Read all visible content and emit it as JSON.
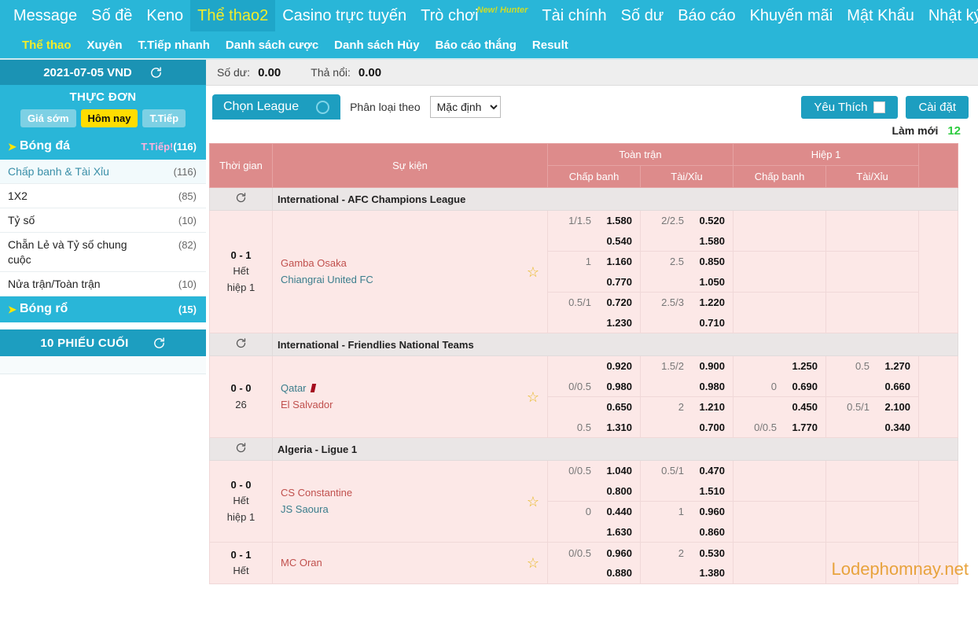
{
  "topnav": {
    "items": [
      {
        "label": "Message",
        "active": false
      },
      {
        "label": "Số đề",
        "active": false
      },
      {
        "label": "Keno",
        "active": false
      },
      {
        "label": "Thể thao2",
        "active": true
      },
      {
        "label": "Casino trực tuyến",
        "active": false
      },
      {
        "label": "Trò chơi",
        "active": false,
        "sup": "New! Hunter"
      },
      {
        "label": "Tài chính",
        "active": false
      },
      {
        "label": "Số dư",
        "active": false
      },
      {
        "label": "Báo cáo",
        "active": false
      },
      {
        "label": "Khuyến mãi",
        "active": false
      },
      {
        "label": "Mật Khẩu",
        "active": false
      },
      {
        "label": "Nhật ký",
        "active": false
      }
    ]
  },
  "subnav": {
    "items": [
      {
        "label": "Thể thao",
        "active": true
      },
      {
        "label": "Xuyên",
        "active": false
      },
      {
        "label": "T.Tiếp nhanh",
        "active": false
      },
      {
        "label": "Danh sách cược",
        "active": false
      },
      {
        "label": "Danh sách Hủy",
        "active": false
      },
      {
        "label": "Báo cáo thắng",
        "active": false
      },
      {
        "label": "Result",
        "active": false
      }
    ]
  },
  "sidebar": {
    "date_label": "2021-07-05 VND",
    "menu_title": "THỰC ĐƠN",
    "tabs": [
      {
        "label": "Giá sớm",
        "selected": false
      },
      {
        "label": "Hôm nay",
        "selected": true
      },
      {
        "label": "T.Tiếp",
        "selected": false
      }
    ],
    "football": {
      "label": "Bóng đá",
      "live": "T.Tiếp!",
      "count": "(116)"
    },
    "items": [
      {
        "label": "Chấp banh & Tài Xỉu",
        "count": "(116)"
      },
      {
        "label": "1X2",
        "count": "(85)"
      },
      {
        "label": "Tỷ số",
        "count": "(10)"
      },
      {
        "label": "Chẵn Lẻ và Tỷ số chung",
        "count": "(82)"
      },
      {
        "label": "cuộc",
        "count": ""
      },
      {
        "label": "Nửa trận/Toàn trận",
        "count": "(10)"
      }
    ],
    "basketball": {
      "label": "Bóng rổ",
      "count": "(15)"
    },
    "last_tickets": "10 PHIẾU CUỐI"
  },
  "balance": {
    "balance_label": "Số dư:",
    "balance_value": "0.00",
    "float_label": "Thả nổi:",
    "float_value": "0.00"
  },
  "controls": {
    "choose_league": "Chọn League",
    "sort_label": "Phân loại theo",
    "sort_value": "Mặc định",
    "sort_options": [
      "Mặc định"
    ],
    "favourite": "Yêu Thích",
    "settings": "Cài đặt",
    "refresh_label": "Làm mới",
    "refresh_value": "12"
  },
  "table": {
    "headers": {
      "time": "Thời gian",
      "event": "Sự kiện",
      "full_match": "Toàn trận",
      "half_1": "Hiệp 1",
      "handicap": "Chấp banh",
      "over_under": "Tài/Xỉu"
    },
    "groups": [
      {
        "league": "International - AFC Champions League",
        "matches": [
          {
            "score": "0 - 1",
            "time_line2": "Hết",
            "time_line3": "hiệp 1",
            "home": "Gamba Osaka",
            "away": "Chiangrai United FC",
            "home_redcard": false,
            "rows": [
              {
                "fm_hcp": [
                  "1/1.5",
                  ""
                ],
                "fm_prc": [
                  "1.580",
                  "0.540"
                ],
                "ou_hcp": [
                  "2/2.5",
                  ""
                ],
                "ou_prc": [
                  "0.520",
                  "1.580"
                ],
                "h1_hcp": [
                  "",
                  ""
                ],
                "h1_prc": [
                  "",
                  ""
                ],
                "h1ou_hcp": [
                  "",
                  ""
                ],
                "h1ou_prc": [
                  "",
                  ""
                ]
              },
              {
                "fm_hcp": [
                  "1",
                  ""
                ],
                "fm_prc": [
                  "1.160",
                  "0.770"
                ],
                "ou_hcp": [
                  "2.5",
                  ""
                ],
                "ou_prc": [
                  "0.850",
                  "1.050"
                ],
                "h1_hcp": [
                  "",
                  ""
                ],
                "h1_prc": [
                  "",
                  ""
                ],
                "h1ou_hcp": [
                  "",
                  ""
                ],
                "h1ou_prc": [
                  "",
                  ""
                ]
              },
              {
                "fm_hcp": [
                  "0.5/1",
                  ""
                ],
                "fm_prc": [
                  "0.720",
                  "1.230"
                ],
                "ou_hcp": [
                  "2.5/3",
                  ""
                ],
                "ou_prc": [
                  "1.220",
                  "0.710"
                ],
                "h1_hcp": [
                  "",
                  ""
                ],
                "h1_prc": [
                  "",
                  ""
                ],
                "h1ou_hcp": [
                  "",
                  ""
                ],
                "h1ou_prc": [
                  "",
                  ""
                ]
              }
            ]
          }
        ]
      },
      {
        "league": "International - Friendlies National Teams",
        "matches": [
          {
            "score": "0 - 0",
            "time_line2": "26",
            "time_line3": "",
            "home": "Qatar",
            "away": "El Salvador",
            "home_redcard": true,
            "home_is_away_color": true,
            "rows": [
              {
                "fm_hcp": [
                  "",
                  "0/0.5"
                ],
                "fm_prc": [
                  "0.920",
                  "0.980"
                ],
                "ou_hcp": [
                  "1.5/2",
                  ""
                ],
                "ou_prc": [
                  "0.900",
                  "0.980"
                ],
                "h1_hcp": [
                  "",
                  "0"
                ],
                "h1_prc": [
                  "1.250",
                  "0.690"
                ],
                "h1ou_hcp": [
                  "0.5",
                  ""
                ],
                "h1ou_prc": [
                  "1.270",
                  "0.660"
                ]
              },
              {
                "fm_hcp": [
                  "",
                  "0.5"
                ],
                "fm_prc": [
                  "0.650",
                  "1.310"
                ],
                "ou_hcp": [
                  "2",
                  ""
                ],
                "ou_prc": [
                  "1.210",
                  "0.700"
                ],
                "h1_hcp": [
                  "",
                  "0/0.5"
                ],
                "h1_prc": [
                  "0.450",
                  "1.770"
                ],
                "h1ou_hcp": [
                  "0.5/1",
                  ""
                ],
                "h1ou_prc": [
                  "2.100",
                  "0.340"
                ]
              }
            ]
          }
        ]
      },
      {
        "league": "Algeria - Ligue 1",
        "matches": [
          {
            "score": "0 - 0",
            "time_line2": "Hết",
            "time_line3": "hiệp 1",
            "home": "CS Constantine",
            "away": "JS Saoura",
            "home_redcard": false,
            "rows": [
              {
                "fm_hcp": [
                  "0/0.5",
                  ""
                ],
                "fm_prc": [
                  "1.040",
                  "0.800"
                ],
                "ou_hcp": [
                  "0.5/1",
                  ""
                ],
                "ou_prc": [
                  "0.470",
                  "1.510"
                ],
                "h1_hcp": [
                  "",
                  ""
                ],
                "h1_prc": [
                  "",
                  ""
                ],
                "h1ou_hcp": [
                  "",
                  ""
                ],
                "h1ou_prc": [
                  "",
                  ""
                ]
              },
              {
                "fm_hcp": [
                  "0",
                  ""
                ],
                "fm_prc": [
                  "0.440",
                  "1.630"
                ],
                "ou_hcp": [
                  "1",
                  ""
                ],
                "ou_prc": [
                  "0.960",
                  "0.860"
                ],
                "h1_hcp": [
                  "",
                  ""
                ],
                "h1_prc": [
                  "",
                  ""
                ],
                "h1ou_hcp": [
                  "",
                  ""
                ],
                "h1ou_prc": [
                  "",
                  ""
                ]
              }
            ]
          },
          {
            "score": "0 - 1",
            "time_line2": "Hết",
            "time_line3": "",
            "home": "MC Oran",
            "away": "",
            "home_redcard": false,
            "rows": [
              {
                "fm_hcp": [
                  "0/0.5",
                  ""
                ],
                "fm_prc": [
                  "0.960",
                  "0.880"
                ],
                "ou_hcp": [
                  "2",
                  ""
                ],
                "ou_prc": [
                  "0.530",
                  "1.380"
                ],
                "h1_hcp": [
                  "",
                  ""
                ],
                "h1_prc": [
                  "",
                  ""
                ],
                "h1ou_hcp": [
                  "",
                  ""
                ],
                "h1ou_prc": [
                  "",
                  ""
                ]
              }
            ]
          }
        ]
      }
    ]
  },
  "watermark": "Lodephomnay.net",
  "colors": {
    "brand_cyan": "#29b6d8",
    "brand_cyan_dark": "#1d9ec0",
    "accent_yellow": "#f2ec2a",
    "table_header_red": "#dd8b8b",
    "row_pink": "#fce8e7",
    "home_team": "#c0504d",
    "away_team": "#3a7d8c",
    "refresh_green": "#2ecc40",
    "watermark_orange": "#e8a33d"
  }
}
